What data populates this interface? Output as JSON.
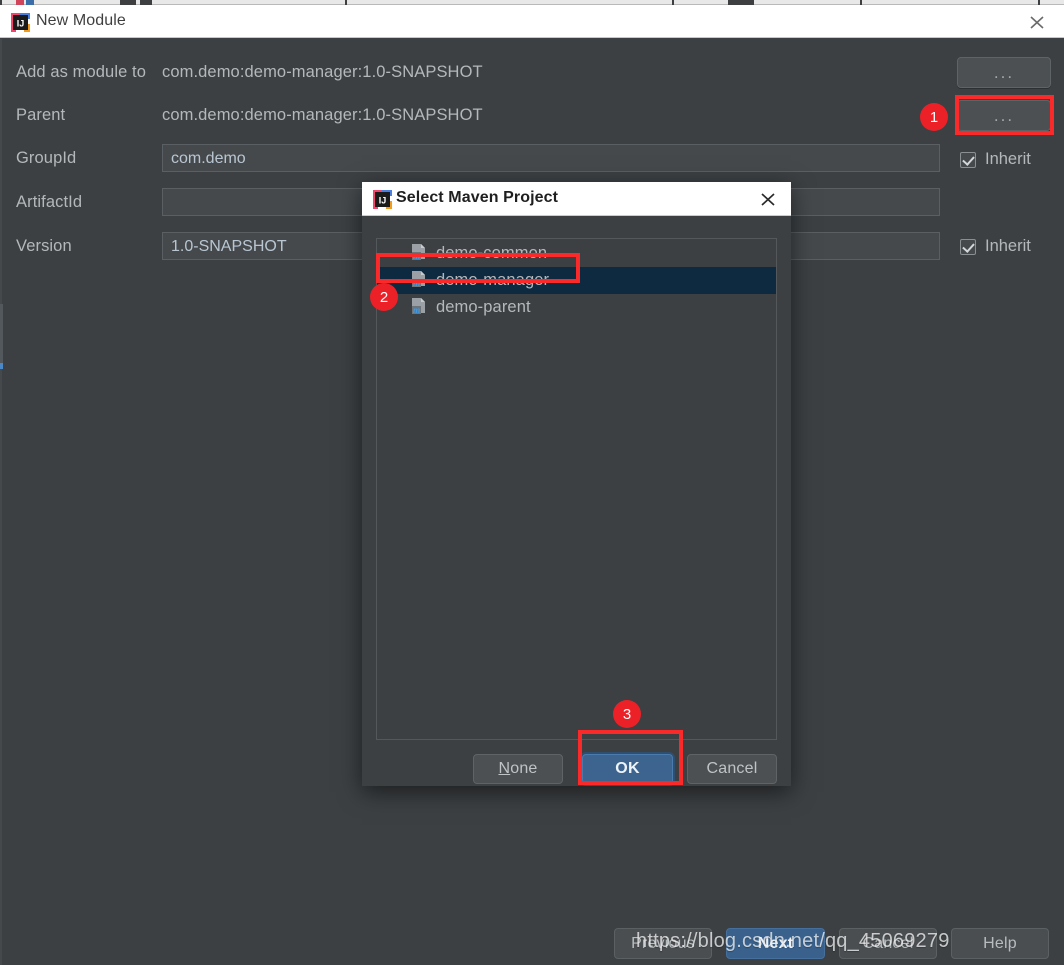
{
  "window": {
    "title": "New Module",
    "close_icon": "close-icon",
    "app_icon": "intellij-idea-logo"
  },
  "form": {
    "rows": [
      {
        "label": "Add as module to",
        "value": "com.demo:demo-manager:1.0-SNAPSHOT"
      },
      {
        "label": "Parent",
        "value": "com.demo:demo-manager:1.0-SNAPSHOT"
      },
      {
        "label": "GroupId",
        "value": "com.demo"
      },
      {
        "label": "ArtifactId",
        "value": ""
      },
      {
        "label": "Version",
        "value": "1.0-SNAPSHOT"
      }
    ],
    "browse_button_label": "...",
    "inherit_label": "Inherit",
    "inherit_checked": true
  },
  "modal": {
    "title": "Select Maven Project",
    "app_icon": "intellij-idea-logo",
    "close_icon": "close-icon",
    "projects": [
      {
        "name": "demo-common",
        "selected": false,
        "icon": "maven-module-icon"
      },
      {
        "name": "demo-manager",
        "selected": true,
        "icon": "maven-module-icon"
      },
      {
        "name": "demo-parent",
        "selected": false,
        "icon": "maven-module-icon"
      }
    ],
    "buttons": {
      "none": "None",
      "none_mnemonic": "N",
      "ok": "OK",
      "cancel": "Cancel"
    }
  },
  "wizard_buttons": {
    "previous": "Previous",
    "next": "Next",
    "cancel": "Cancel",
    "help": "Help"
  },
  "annotations": {
    "badge1": "1",
    "badge2": "2",
    "badge3": "3",
    "accent_color": "#ec2127"
  },
  "watermark": {
    "text": "https://blog.csdn.net/qq_45069279"
  }
}
